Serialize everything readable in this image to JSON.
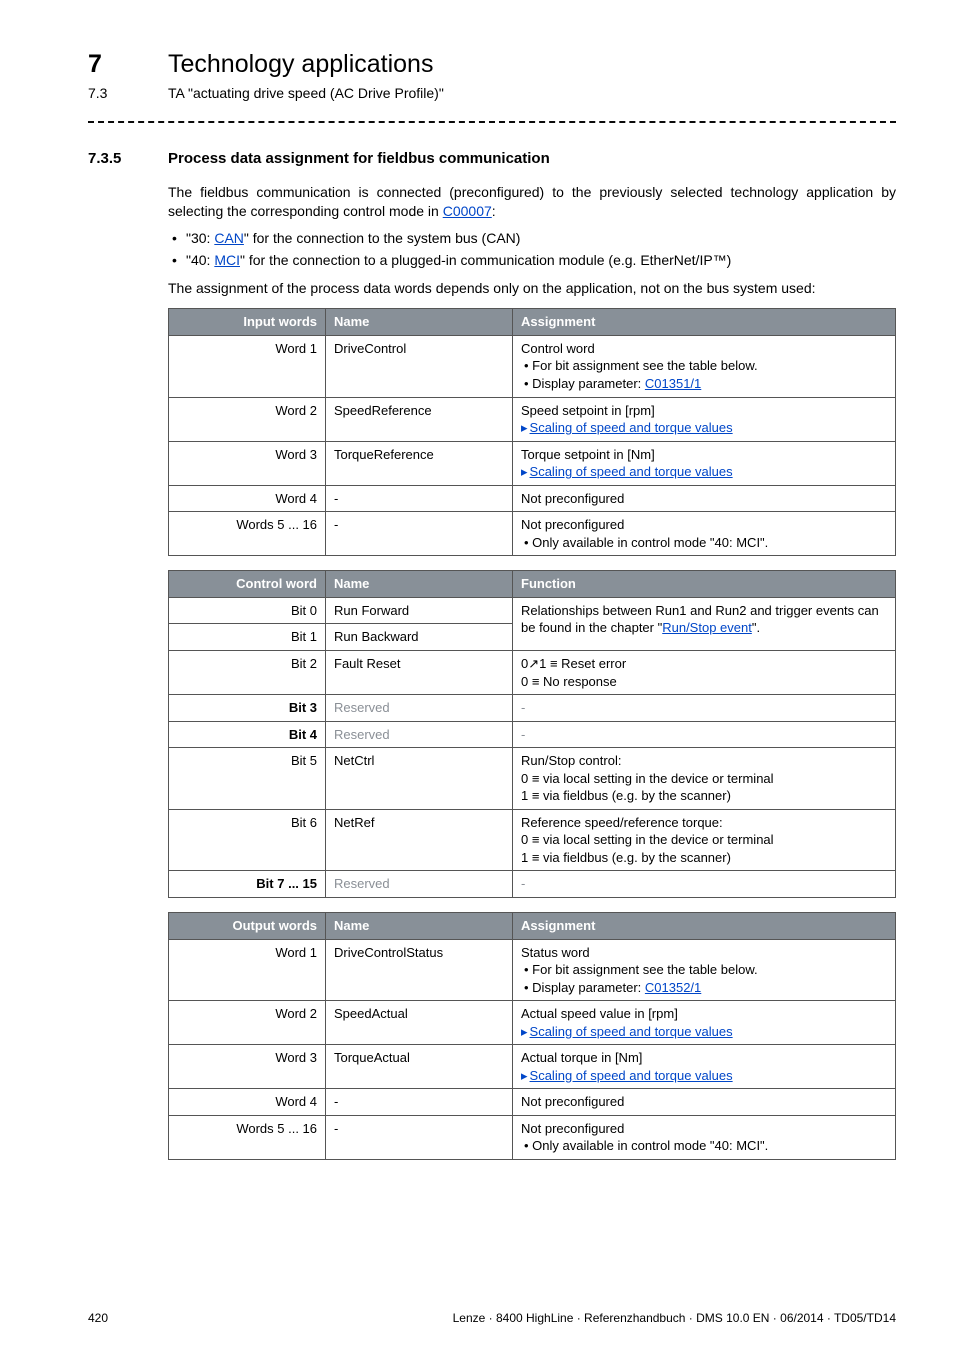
{
  "header": {
    "chapter_number": "7",
    "chapter_title": "Technology applications",
    "sub_number": "7.3",
    "sub_title": "TA \"actuating drive speed (AC Drive Profile)\""
  },
  "section": {
    "number": "7.3.5",
    "title": "Process data assignment for fieldbus communication"
  },
  "intro": {
    "p1_a": "The fieldbus communication is connected (preconfigured) to the previously selected technology application by selecting the corresponding control mode in ",
    "p1_link": "C00007",
    "p1_b": ":",
    "bullets": [
      {
        "pre": "\"30: ",
        "link": "CAN",
        "post": "\" for the connection to the system bus (CAN)"
      },
      {
        "pre": "\"40: ",
        "link": "MCI",
        "post": "\" for the connection to a plugged-in communication module (e.g. EtherNet/IP™)"
      }
    ],
    "p2": "The assignment of the process data words depends only on the application, not on the bus system used:"
  },
  "table1": {
    "head": [
      "Input words",
      "Name",
      "Assignment"
    ],
    "rows": [
      {
        "c0": "Word 1",
        "c1": "DriveControl",
        "assign": {
          "line1": "Control word",
          "sub1": "For bit assignment see the table below.",
          "sub2_pre": "Display parameter: ",
          "sub2_link": "C01351/1"
        }
      },
      {
        "c0": "Word 2",
        "c1": "SpeedReference",
        "assign": {
          "line1": "Speed setpoint in [rpm]",
          "play": "Scaling of speed and torque values"
        }
      },
      {
        "c0": "Word 3",
        "c1": "TorqueReference",
        "assign": {
          "line1": "Torque setpoint in [Nm]",
          "play": "Scaling of speed and torque values"
        }
      },
      {
        "c0": "Word 4",
        "c1": "-",
        "assign": {
          "line1": "Not preconfigured"
        }
      },
      {
        "c0": "Words 5 ... 16",
        "c1": "-",
        "assign": {
          "line1": "Not preconfigured",
          "sub1": "Only available in control mode \"40: MCI\"."
        }
      }
    ]
  },
  "table2": {
    "head": [
      "Control word",
      "Name",
      "Function"
    ],
    "rows": [
      {
        "c0": "Bit 0",
        "c1": "Run Forward",
        "func_span_text_a": "Relationships between Run1 and Run2 and trigger events can be found in the chapter \"",
        "func_span_link": "Run/Stop event",
        "func_span_text_b": "\".",
        "rowspan": 2
      },
      {
        "c0": "Bit 1",
        "c1": "Run Backward"
      },
      {
        "c0": "Bit 2",
        "c1": "Fault Reset",
        "lines": [
          "0↗1 ≡ Reset error",
          "0 ≡ No response"
        ]
      },
      {
        "c0": "Bit 3",
        "c1_grey": "Reserved",
        "lines_grey": [
          "-"
        ],
        "left_bold": true
      },
      {
        "c0": "Bit 4",
        "c1_grey": "Reserved",
        "lines_grey": [
          "-"
        ],
        "left_bold": true
      },
      {
        "c0": "Bit 5",
        "c1": "NetCtrl",
        "lines": [
          "Run/Stop control:",
          "0 ≡ via local setting in the device or terminal",
          "1 ≡ via fieldbus (e.g. by the scanner)"
        ]
      },
      {
        "c0": "Bit 6",
        "c1": "NetRef",
        "lines": [
          "Reference speed/reference torque:",
          "0 ≡ via local setting in the device or terminal",
          "1 ≡ via fieldbus (e.g. by the scanner)"
        ]
      },
      {
        "c0": "Bit 7 ... 15",
        "c1_grey": "Reserved",
        "lines_grey": [
          "-"
        ],
        "left_bold": true
      }
    ]
  },
  "table3": {
    "head": [
      "Output words",
      "Name",
      "Assignment"
    ],
    "rows": [
      {
        "c0": "Word 1",
        "c1": "DriveControlStatus",
        "assign": {
          "line1": "Status word",
          "sub1": "For bit assignment see the table below.",
          "sub2_pre": "Display parameter: ",
          "sub2_link": "C01352/1"
        }
      },
      {
        "c0": "Word 2",
        "c1": "SpeedActual",
        "assign": {
          "line1": "Actual speed value in [rpm]",
          "play": "Scaling of speed and torque values"
        }
      },
      {
        "c0": "Word 3",
        "c1": "TorqueActual",
        "assign": {
          "line1": "Actual torque in [Nm]",
          "play": "Scaling of speed and torque values"
        }
      },
      {
        "c0": "Word 4",
        "c1": "-",
        "assign": {
          "line1": "Not preconfigured"
        }
      },
      {
        "c0": "Words 5 ... 16",
        "c1": "-",
        "assign": {
          "line1": "Not preconfigured",
          "sub1": "Only available in control mode \"40: MCI\"."
        }
      }
    ]
  },
  "footer": {
    "page": "420",
    "doc": "Lenze · 8400 HighLine · Referenzhandbuch · DMS 10.0 EN · 06/2014 · TD05/TD14"
  }
}
